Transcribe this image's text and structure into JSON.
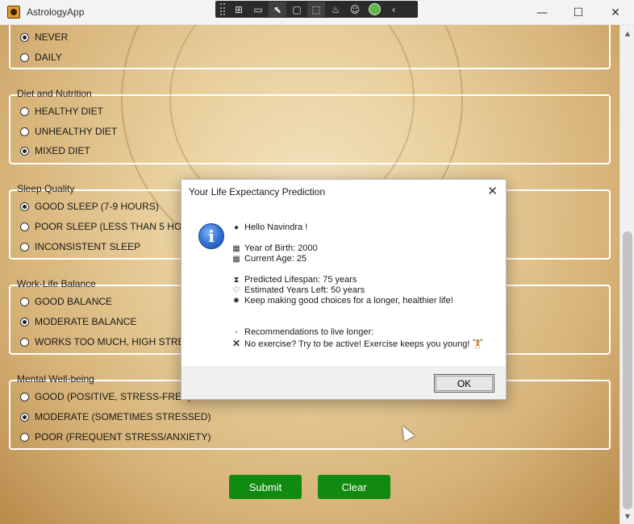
{
  "window": {
    "title": "AstrologyApp",
    "minimize": "—",
    "maximize": "☐",
    "close": "✕"
  },
  "debug_toolbar": {
    "icons": [
      "live-visual-tree-icon",
      "record-icon",
      "select-element-icon",
      "display-layout-adorners-icon",
      "track-focus-icon",
      "hot-reload-icon",
      "accessibility-icon",
      "status-ok-icon",
      "collapse-icon"
    ]
  },
  "form": {
    "exercise": {
      "options": [
        {
          "label": "NEVER",
          "checked": true
        },
        {
          "label": "DAILY",
          "checked": false
        }
      ]
    },
    "diet": {
      "label": "Diet and Nutrition",
      "options": [
        {
          "label": "HEALTHY DIET",
          "checked": false
        },
        {
          "label": "UNHEALTHY DIET",
          "checked": false
        },
        {
          "label": "MIXED DIET",
          "checked": true
        }
      ]
    },
    "sleep": {
      "label": "Sleep Quality",
      "options": [
        {
          "label": "GOOD SLEEP (7-9 HOURS)",
          "checked": true
        },
        {
          "label": "POOR SLEEP (LESS THAN 5 HOURS)",
          "checked": false
        },
        {
          "label": "INCONSISTENT SLEEP",
          "checked": false
        }
      ]
    },
    "worklife": {
      "label": "Work-Life Balance",
      "options": [
        {
          "label": "GOOD BALANCE",
          "checked": false
        },
        {
          "label": "MODERATE BALANCE",
          "checked": true
        },
        {
          "label": "WORKS TOO MUCH, HIGH STRESS",
          "checked": false
        }
      ]
    },
    "mental": {
      "label": "Mental Well-being",
      "options": [
        {
          "label": "GOOD (POSITIVE, STRESS-FREE)",
          "checked": false
        },
        {
          "label": "MODERATE (SOMETIMES STRESSED)",
          "checked": true
        },
        {
          "label": "POOR (FREQUENT STRESS/ANXIETY)",
          "checked": false
        }
      ]
    },
    "submit_label": "Submit",
    "clear_label": "Clear",
    "accent_color": "#108a10"
  },
  "dialog": {
    "title": "Your Life Expectancy Prediction",
    "close": "✕",
    "icon": "information-icon",
    "greeting": "Hello Navindra !",
    "year_of_birth": "Year of Birth: 2000",
    "current_age": "Current Age: 25",
    "predicted_lifespan": "Predicted Lifespan: 75 years",
    "years_left": "Estimated Years Left: 50 years",
    "encouragement": "Keep making good choices for a longer, healthier life!",
    "recommendations_header": "Recommendations to live longer:",
    "recommendation_1": "No exercise? Try to be active! Exercise keeps you young! 🏋",
    "ok_label": "OK"
  }
}
